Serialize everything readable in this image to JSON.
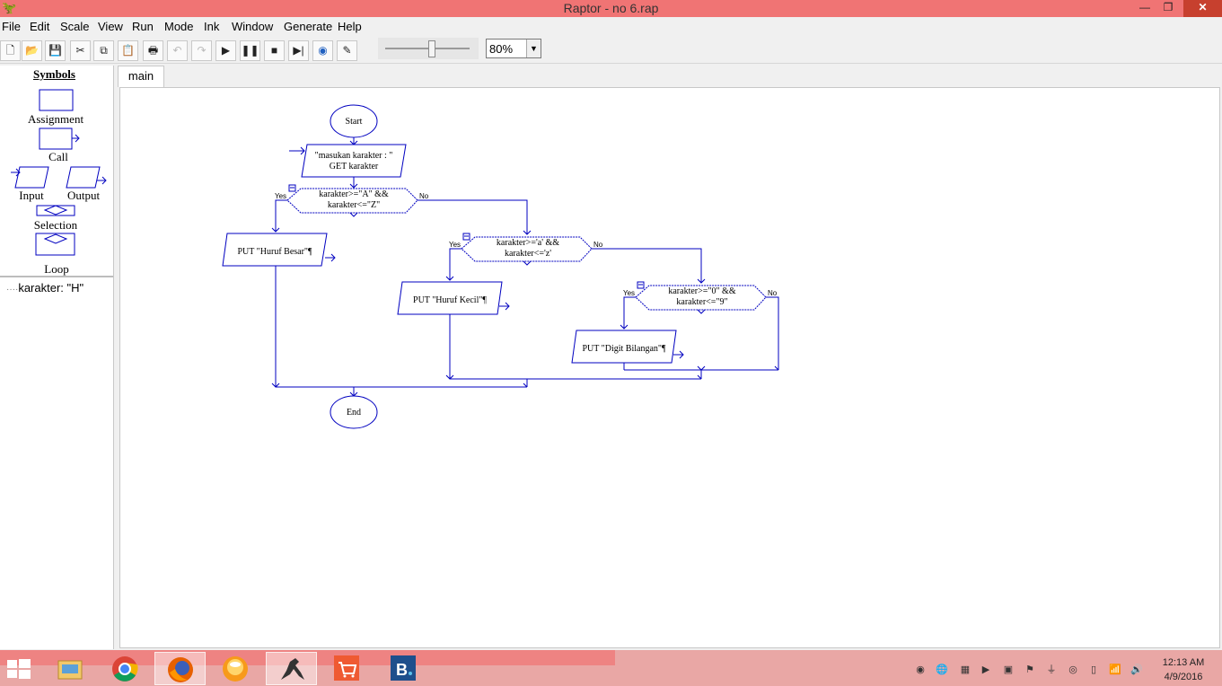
{
  "window": {
    "title": "Raptor - no 6.rap",
    "minimize": "—",
    "maximize": "❐",
    "close": "✕"
  },
  "menu": [
    "File",
    "Edit",
    "Scale",
    "View",
    "Run",
    "Mode",
    "Ink",
    "Window",
    "Generate",
    "Help"
  ],
  "toolbar": {
    "buttons": [
      "new-icon",
      "open-icon",
      "save-icon",
      "cut-icon",
      "copy-icon",
      "paste-icon",
      "print-icon",
      "undo-icon",
      "redo-icon",
      "play-icon",
      "pause-icon",
      "stop-icon",
      "step-icon",
      "test-server-icon",
      "pen-icon"
    ],
    "zoom_value": "80%",
    "speed_slider_level": 0.55
  },
  "symbols": {
    "title": "Symbols",
    "assignment": "Assignment",
    "call": "Call",
    "input": "Input",
    "output": "Output",
    "selection": "Selection",
    "loop": "Loop"
  },
  "variables": [
    {
      "text": "karakter: \"H\""
    }
  ],
  "tabs": [
    {
      "label": "main"
    }
  ],
  "flowchart": {
    "start": "Start",
    "end": "End",
    "input_prompt": "\"masukan karakter : \"",
    "input_get": "GET karakter",
    "sel1_line1": "karakter>=\"A\" &&",
    "sel1_line2": "karakter<=\"Z\"",
    "out1": "PUT \"Huruf Besar\"¶",
    "sel2_line1": "karakter>='a' &&",
    "sel2_line2": "karakter<='z'",
    "out2": "PUT \"Huruf Kecil\"¶",
    "sel3_line1": "karakter>=\"0\" &&",
    "sel3_line2": "karakter<=\"9\"",
    "out3": "PUT \"Digit Bilangan\"¶",
    "yes": "Yes",
    "no": "No"
  },
  "taskbar": {
    "apps": [
      "file-explorer-icon",
      "chrome-icon",
      "firefox-icon",
      "messenger-icon",
      "raptor-icon",
      "store-icon",
      "b-app-icon"
    ],
    "clock_time": "12:13 AM",
    "clock_date": "4/9/2016"
  },
  "colors": {
    "titlebar": "#f07474",
    "flow_line": "#0000c0",
    "taskbar": "#e9a7a5"
  }
}
